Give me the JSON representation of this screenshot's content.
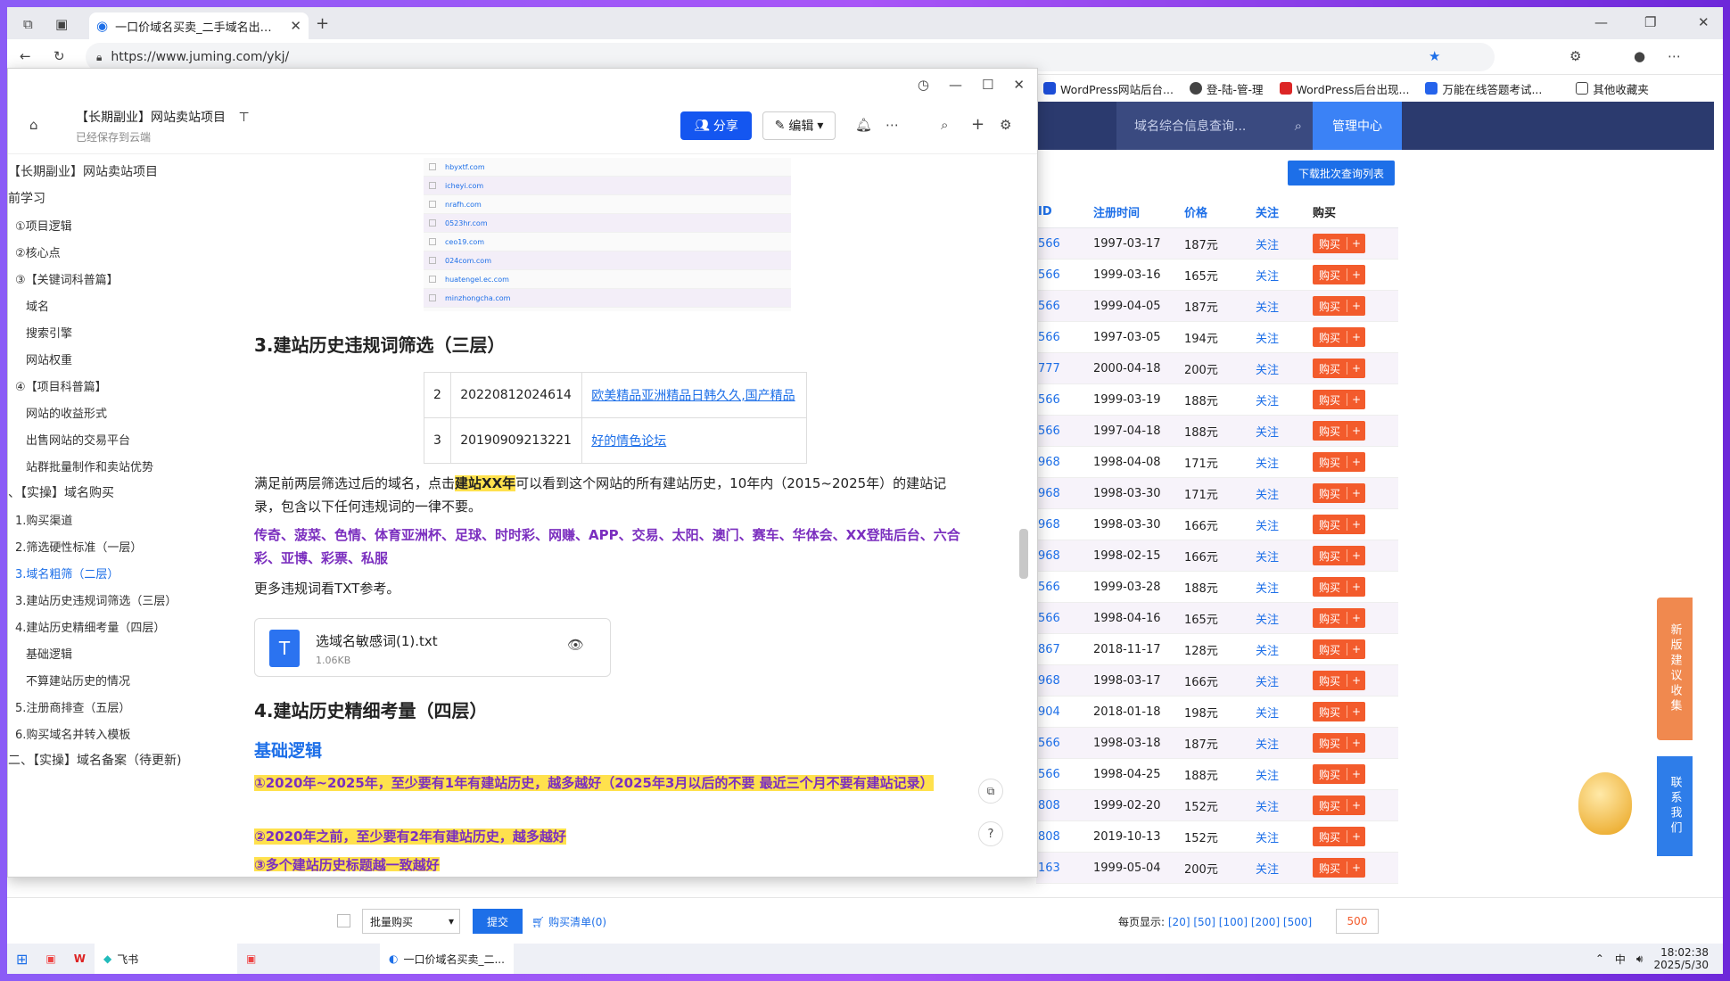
{
  "browser": {
    "tab_title": "一口价域名买卖_二手域名出售交易",
    "url": "https://www.juming.com/ykj/",
    "bookmarks": [
      "WordPress网站后台...",
      "登-陆-管-理",
      "WordPress后台出现...",
      "万能在线答题考试...",
      "其他收藏夹"
    ]
  },
  "site": {
    "search_placeholder": "域名综合信息查询...",
    "admin": "管理中心",
    "download": "下载批次查询列表",
    "headers": {
      "id": "ID",
      "date": "注册时间",
      "price": "价格",
      "fav": "关注",
      "buy": "购买"
    },
    "rows": [
      {
        "id": "566",
        "date": "1997-03-17",
        "price": "187元"
      },
      {
        "id": "566",
        "date": "1999-03-16",
        "price": "165元"
      },
      {
        "id": "566",
        "date": "1999-04-05",
        "price": "187元"
      },
      {
        "id": "566",
        "date": "1997-03-05",
        "price": "194元"
      },
      {
        "id": "777",
        "date": "2000-04-18",
        "price": "200元"
      },
      {
        "id": "566",
        "date": "1999-03-19",
        "price": "188元"
      },
      {
        "id": "566",
        "date": "1997-04-18",
        "price": "188元"
      },
      {
        "id": "968",
        "date": "1998-04-08",
        "price": "171元"
      },
      {
        "id": "968",
        "date": "1998-03-30",
        "price": "171元"
      },
      {
        "id": "968",
        "date": "1998-03-30",
        "price": "166元"
      },
      {
        "id": "968",
        "date": "1998-02-15",
        "price": "166元"
      },
      {
        "id": "566",
        "date": "1999-03-28",
        "price": "188元"
      },
      {
        "id": "566",
        "date": "1998-04-16",
        "price": "165元"
      },
      {
        "id": "867",
        "date": "2018-11-17",
        "price": "128元"
      },
      {
        "id": "968",
        "date": "1998-03-17",
        "price": "166元"
      },
      {
        "id": "904",
        "date": "2018-01-18",
        "price": "198元"
      },
      {
        "id": "566",
        "date": "1998-03-18",
        "price": "187元"
      },
      {
        "id": "566",
        "date": "1998-04-25",
        "price": "188元"
      },
      {
        "id": "808",
        "date": "1999-02-20",
        "price": "152元"
      },
      {
        "id": "808",
        "date": "2019-10-13",
        "price": "152元"
      },
      {
        "id": "163",
        "date": "1999-05-04",
        "price": "200元"
      }
    ],
    "fav_label": "关注",
    "buy_label": "购买",
    "footer": {
      "batch": "批量购买",
      "submit": "提交",
      "cart": "购买清单(0)",
      "per_page": "每页显示:",
      "pages": "[20] [50] [100] [200] [500]",
      "page_value": "500"
    },
    "side_feedback": "新版建议收集",
    "side_contact": "联系我们"
  },
  "doc": {
    "title": "【长期副业】网站卖站项目",
    "saved": "已经保存到云端",
    "share": "分享",
    "edit": "编辑",
    "outline": [
      {
        "t": "【长期副业】网站卖站项目",
        "lvl": 0
      },
      {
        "t": "前学习",
        "lvl": 0
      },
      {
        "t": "①项目逻辑",
        "lvl": 1
      },
      {
        "t": "②核心点",
        "lvl": 1
      },
      {
        "t": "③【关键词科普篇】",
        "lvl": 1
      },
      {
        "t": "域名",
        "lvl": 2
      },
      {
        "t": "搜索引擎",
        "lvl": 2
      },
      {
        "t": "网站权重",
        "lvl": 2
      },
      {
        "t": "④【项目科普篇】",
        "lvl": 1
      },
      {
        "t": "网站的收益形式",
        "lvl": 2
      },
      {
        "t": "出售网站的交易平台",
        "lvl": 2
      },
      {
        "t": "站群批量制作和卖站优势",
        "lvl": 2
      },
      {
        "t": "、【实操】域名购买",
        "lvl": 0
      },
      {
        "t": "1.购买渠道",
        "lvl": 1
      },
      {
        "t": "2.筛选硬性标准（一层）",
        "lvl": 1
      },
      {
        "t": "3.域名粗筛（二层）",
        "lvl": 1,
        "active": true
      },
      {
        "t": "3.建站历史违规词筛选（三层）",
        "lvl": 1
      },
      {
        "t": "4.建站历史精细考量（四层）",
        "lvl": 1
      },
      {
        "t": "基础逻辑",
        "lvl": 2
      },
      {
        "t": "不算建站历史的情况",
        "lvl": 2
      },
      {
        "t": "5.注册商排查（五层）",
        "lvl": 1
      },
      {
        "t": "6.购买域名并转入模板",
        "lvl": 1
      },
      {
        "t": "二、【实操】域名备案（待更新)",
        "lvl": 0
      }
    ],
    "shot_rows": [
      "hbyxtf.com",
      "icheyi.com",
      "nrafh.com",
      "0523hr.com",
      "ceo19.com",
      "024com.com",
      "huatengel.ec.com",
      "minzhongcha.com"
    ],
    "sec3": "3.建站历史违规词筛选（三层）",
    "table": [
      {
        "n": "2",
        "id": "20220812024614",
        "link": "欧美精品亚洲精品日韩久久,国产精品"
      },
      {
        "n": "3",
        "id": "20190909213221",
        "link": "好的情色论坛"
      }
    ],
    "p1a": "满足前两层筛选过后的域名，点击",
    "p1hl": "建站XX年",
    "p1b": "可以看到这个网站的所有建站历史，10年内（2015~2025年）的建站记录，包含以下任何违规词的一律不要。",
    "words": "传奇、菠菜、色情、体育亚洲杯、足球、时时彩、网赚、APP、交易、太阳、澳门、赛车、华体会、XX登陆后台、六合彩、亚博、彩票、私服",
    "more": "更多违规词看TXT参考。",
    "file_name": "选域名敏感词(1).txt",
    "file_size": "1.06KB",
    "sec4": "4.建站历史精细考量（四层）",
    "sub": "基础逻辑",
    "r1": "①2020年~2025年，至少要有1年有建站历史，越多越好（2025年3月以后的不要 最近三个月不要有建站记录）",
    "r2": "②2020年之前，至少要有2年有建站历史，越多越好",
    "r3": "③多个建站历史标题越一致越好"
  },
  "taskbar": {
    "app1": "飞书",
    "app2": "一口价域名买卖_二...",
    "time": "18:02:38",
    "date": "2025/5/30",
    "ime": "中"
  }
}
